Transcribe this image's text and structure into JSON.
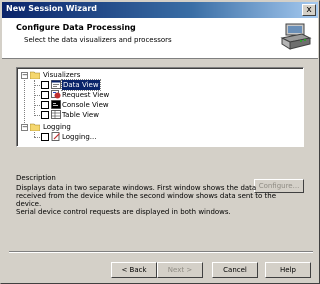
{
  "window": {
    "title": "New Session Wizard",
    "close_glyph": "x"
  },
  "header": {
    "title": "Configure Data Processing",
    "subtitle": "Select the data visualizers and processors",
    "icon": "network-devices-icon"
  },
  "tree": {
    "groups": [
      {
        "label": "Visualizers",
        "expander": "−",
        "items": [
          {
            "label": "Data View",
            "selected": true,
            "icon": "data-view-icon"
          },
          {
            "label": "Request View",
            "selected": false,
            "icon": "request-view-icon"
          },
          {
            "label": "Console View",
            "selected": false,
            "icon": "console-view-icon"
          },
          {
            "label": "Table View",
            "selected": false,
            "icon": "table-view-icon"
          }
        ]
      },
      {
        "label": "Logging",
        "expander": "−",
        "items": [
          {
            "label": "Logging...",
            "selected": false,
            "icon": "logging-icon"
          }
        ]
      }
    ]
  },
  "description": {
    "label": "Description",
    "lines": [
      "Displays data in two separate windows. First window shows the data",
      "received from the device while the second window shows data sent to the",
      "device.",
      "Serial device control requests are displayed in both windows."
    ],
    "configure_label": "Configure..."
  },
  "buttons": {
    "back": "< Back",
    "next": "Next >",
    "cancel": "Cancel",
    "help": "Help"
  }
}
